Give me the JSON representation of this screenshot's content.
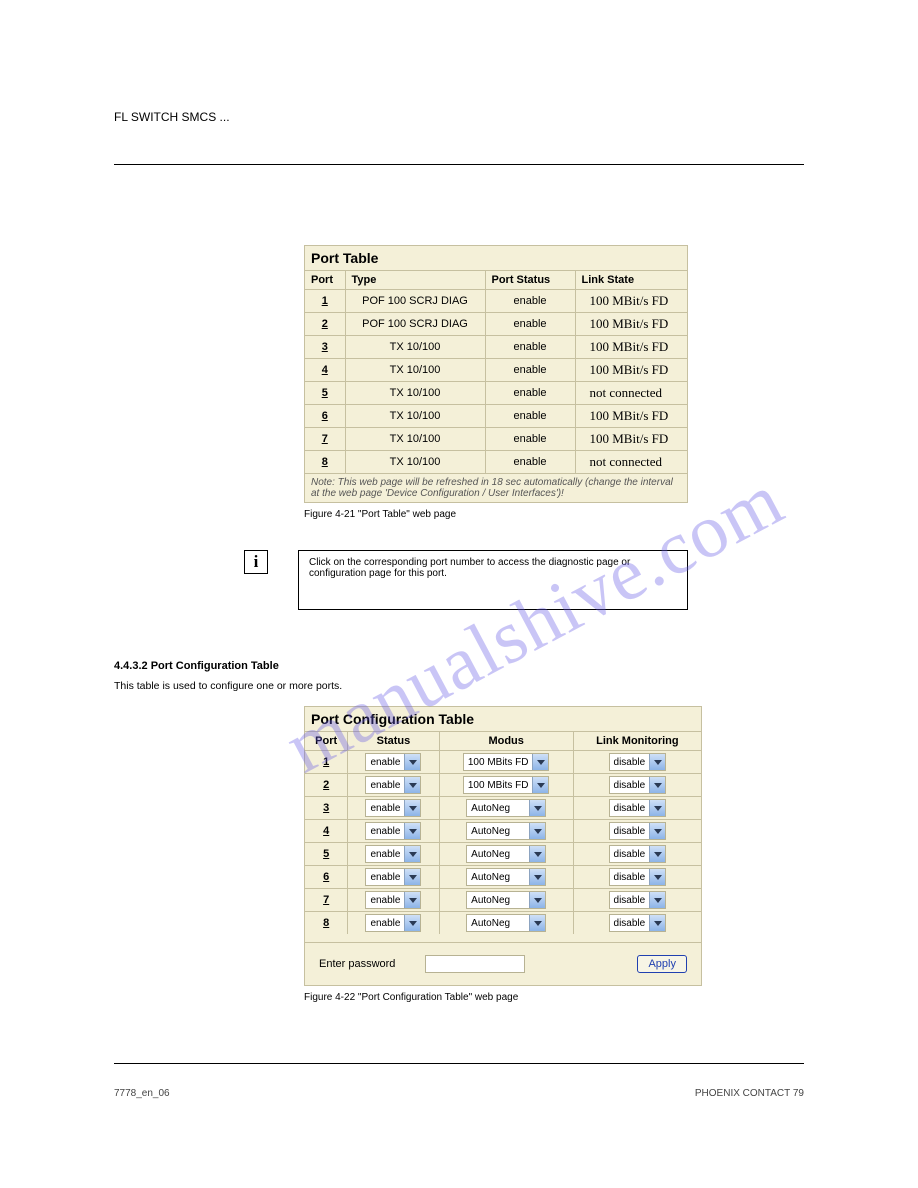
{
  "header": {
    "left": "FL SWITCH SMCS ...",
    "right": ""
  },
  "watermark": "manualshive.com",
  "portTable": {
    "title": "Port Table",
    "headers": [
      "Port",
      "Type",
      "Port Status",
      "Link State"
    ],
    "rows": [
      {
        "port": "1",
        "type": "POF 100 SCRJ DIAG",
        "status": "enable",
        "link": "100 MBit/s FD"
      },
      {
        "port": "2",
        "type": "POF 100 SCRJ DIAG",
        "status": "enable",
        "link": "100 MBit/s FD"
      },
      {
        "port": "3",
        "type": "TX 10/100",
        "status": "enable",
        "link": "100 MBit/s FD"
      },
      {
        "port": "4",
        "type": "TX 10/100",
        "status": "enable",
        "link": "100 MBit/s FD"
      },
      {
        "port": "5",
        "type": "TX 10/100",
        "status": "enable",
        "link": "not connected"
      },
      {
        "port": "6",
        "type": "TX 10/100",
        "status": "enable",
        "link": "100 MBit/s FD"
      },
      {
        "port": "7",
        "type": "TX 10/100",
        "status": "enable",
        "link": "100 MBit/s FD"
      },
      {
        "port": "8",
        "type": "TX 10/100",
        "status": "enable",
        "link": "not connected"
      }
    ],
    "note": "Note: This web page will be refreshed in 18 sec automatically (change the interval at the web page 'Device Configuration / User Interfaces')!",
    "caption": "Figure 4-21   \"Port Table\" web page"
  },
  "infoIcon": "i",
  "infoText": "Click on the corresponding port number to access the diagnostic page or configuration page for this port.",
  "section": {
    "h1": "4.4.3.2   Port Configuration Table",
    "body": "This table is used to configure one or more ports."
  },
  "cfgTable": {
    "title": "Port Configuration Table",
    "headers": [
      "Port",
      "Status",
      "Modus",
      "Link Monitoring"
    ],
    "rows": [
      {
        "port": "1",
        "status": "enable",
        "modus": "100 MBits FD",
        "link": "disable"
      },
      {
        "port": "2",
        "status": "enable",
        "modus": "100 MBits FD",
        "link": "disable"
      },
      {
        "port": "3",
        "status": "enable",
        "modus": "AutoNeg",
        "link": "disable"
      },
      {
        "port": "4",
        "status": "enable",
        "modus": "AutoNeg",
        "link": "disable"
      },
      {
        "port": "5",
        "status": "enable",
        "modus": "AutoNeg",
        "link": "disable"
      },
      {
        "port": "6",
        "status": "enable",
        "modus": "AutoNeg",
        "link": "disable"
      },
      {
        "port": "7",
        "status": "enable",
        "modus": "AutoNeg",
        "link": "disable"
      },
      {
        "port": "8",
        "status": "enable",
        "modus": "AutoNeg",
        "link": "disable"
      }
    ],
    "enterPassword": "Enter password",
    "applyLabel": "Apply",
    "caption": "Figure 4-22   \"Port Configuration Table\" web page"
  },
  "footer": {
    "left": "7778_en_06",
    "right": "PHOENIX CONTACT   79"
  }
}
